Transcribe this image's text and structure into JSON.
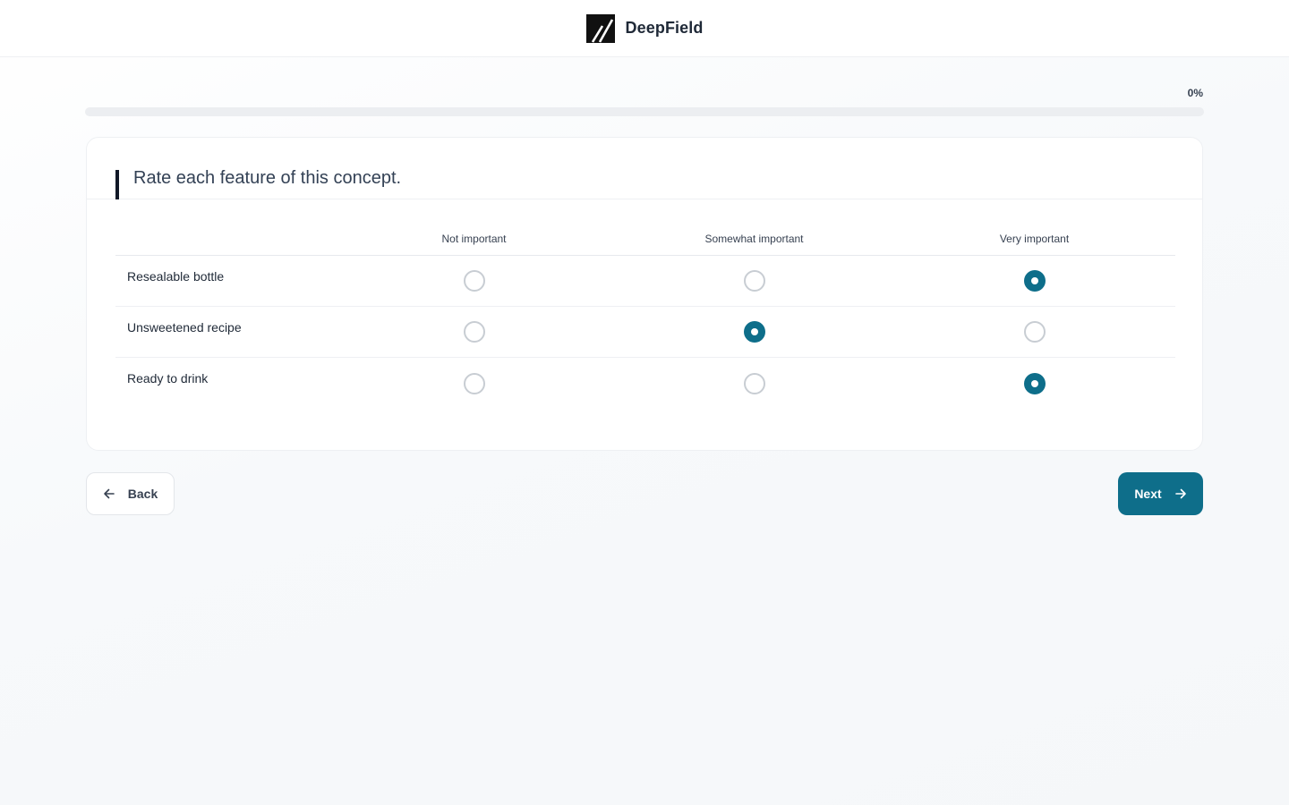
{
  "header": {
    "brand_name": "DeepField",
    "logo_icon": "deepfield-logo-icon"
  },
  "progress": {
    "label": "0%",
    "percent": 0
  },
  "question": {
    "title": "Rate each feature of this concept.",
    "columns": [
      "Not important",
      "Somewhat important",
      "Very important"
    ],
    "rows": [
      {
        "label": "Resealable bottle",
        "selected_index": 2
      },
      {
        "label": "Unsweetened recipe",
        "selected_index": 1
      },
      {
        "label": "Ready to drink",
        "selected_index": 2
      }
    ]
  },
  "nav": {
    "back_label": "Back",
    "back_icon": "arrow-left-icon",
    "next_label": "Next",
    "next_icon": "arrow-right-icon"
  },
  "colors": {
    "accent": "#0e6e8a",
    "text": "#1f2937",
    "border": "#eef0f3"
  }
}
